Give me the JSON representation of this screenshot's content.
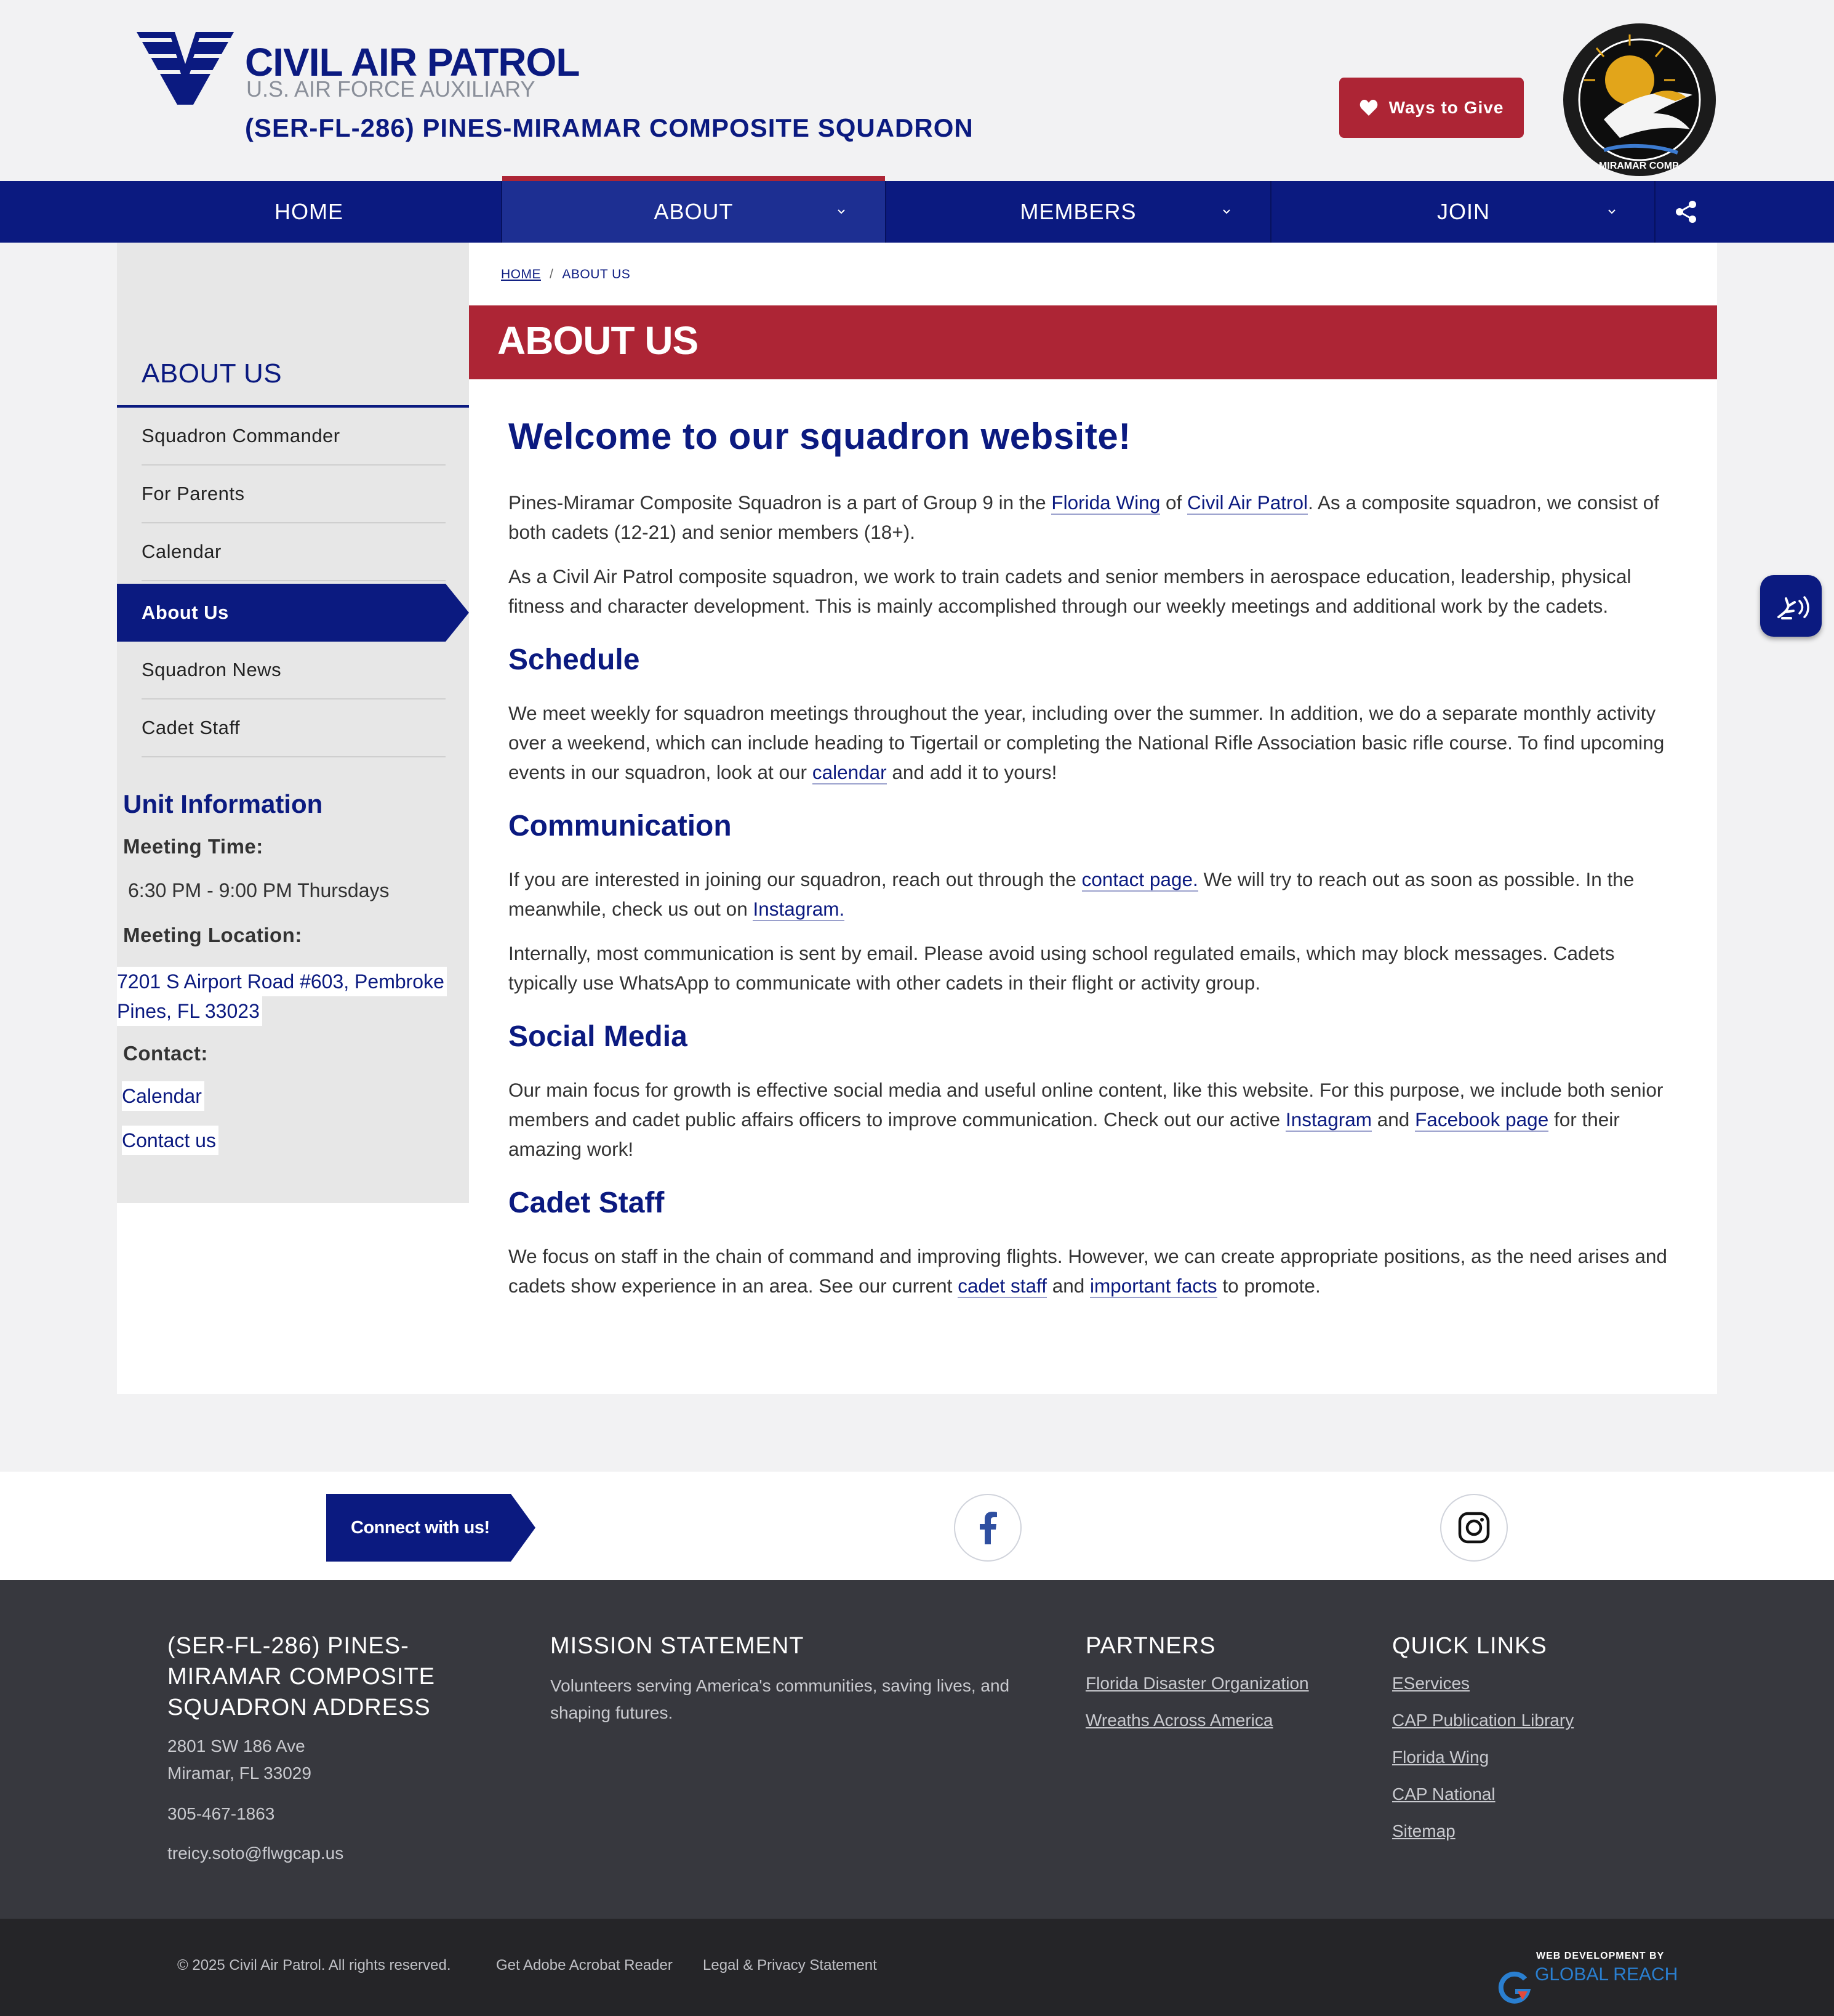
{
  "header": {
    "logo_main": "CIVIL AIR PATROL",
    "logo_sub": "U.S. AIR FORCE AUXILIARY",
    "squadron_name": "(SER-FL-286) PINES-MIRAMAR COMPOSITE SQUADRON",
    "give_label": "Ways to Give",
    "badge_text": "PINES - MIRAMAR COMP. SQUADRON"
  },
  "nav": {
    "items": [
      {
        "label": "HOME"
      },
      {
        "label": "ABOUT"
      },
      {
        "label": "MEMBERS"
      },
      {
        "label": "JOIN"
      }
    ]
  },
  "breadcrumb": {
    "home": "HOME",
    "sep": "/",
    "current": "ABOUT US"
  },
  "sidebar": {
    "title": "ABOUT US",
    "items": [
      {
        "label": "Squadron Commander"
      },
      {
        "label": "For Parents"
      },
      {
        "label": "Calendar"
      },
      {
        "label": "About Us"
      },
      {
        "label": "Squadron News"
      },
      {
        "label": "Cadet Staff"
      }
    ],
    "unit": {
      "title": "Unit Information",
      "meeting_time_label": "Meeting Time:",
      "meeting_time": "6:30 PM - 9:00 PM Thursdays",
      "meeting_location_label": "Meeting Location:",
      "address_line1": "7201 S Airport Road #603, Pembroke",
      "address_line2": "Pines, FL 33023",
      "contact_label": "Contact:",
      "calendar_link": "Calendar",
      "contact_link": "Contact us"
    }
  },
  "page": {
    "banner_title": "ABOUT US",
    "welcome": "Welcome to our squadron website!",
    "intro": {
      "t1": "Pines-Miramar Composite Squadron is a part of Group 9 in the ",
      "l1": "Florida Wing",
      "t2": " of ",
      "l2": "Civil Air Patrol",
      "t3": ". As a composite squadron, we consist of both cadets (12-21) and senior members (18+)."
    },
    "intro2": "As a Civil Air Patrol composite squadron, we work to train cadets and senior members in aerospace education, leadership, physical fitness and character development. This is mainly accomplished through our weekly meetings and additional work by the cadets.",
    "schedule_heading": "Schedule",
    "schedule": {
      "t1": "We meet weekly for squadron meetings throughout the year, including over the summer. In addition, we do a separate monthly activity over a weekend, which can include heading to Tigertail or completing the National Rifle Association basic rifle course. To find upcoming events in our squadron, look at our ",
      "l1": "calendar",
      "t2": " and add it to yours!"
    },
    "communication_heading": "Communication",
    "communication": {
      "t1": "If you are interested in joining our squadron, reach out through the ",
      "l1": "contact page.",
      "t2": " We will try to reach out as soon as possible. In the meanwhile, check us out on ",
      "l2": "Instagram."
    },
    "communication2": "Internally, most communication is sent by email. Please avoid using school regulated emails, which may block messages. Cadets typically use WhatsApp to communicate with other cadets in their flight or activity group.",
    "social_heading": "Social Media",
    "social": {
      "t1": "Our main focus for growth is effective social media and useful online content, like this website. For this purpose, we include both senior members and cadet public affairs officers to improve communication. Check out our active ",
      "l1": "Instagram",
      "t2": " and ",
      "l2": "Facebook page",
      "t3": " for their amazing work!"
    },
    "cadet_heading": "Cadet Staff",
    "cadet": {
      "t1": "We focus on staff in the chain of command and improving flights. However, we can create appropriate positions, as the need arises and cadets show experience in an area. See our current ",
      "l1": "cadet staff",
      "t2": " and ",
      "l2": "important facts",
      "t3": " to promote."
    }
  },
  "connect": {
    "label": "Connect with us!",
    "icons": [
      "facebook-icon",
      "instagram-icon"
    ]
  },
  "footer": {
    "address_heading": "(SER-FL-286) PINES-MIRAMAR COMPOSITE SQUADRON ADDRESS",
    "address_line1": "2801 SW 186 Ave",
    "address_line2": "Miramar, FL 33029",
    "phone": "305-467-1863",
    "email": "treicy.soto@flwgcap.us",
    "mission_heading": "MISSION STATEMENT",
    "mission": "Volunteers serving America's communities, saving lives, and shaping futures.",
    "partners_heading": "PARTNERS",
    "partners": [
      {
        "label": "Florida Disaster Organization"
      },
      {
        "label": "Wreaths Across America"
      }
    ],
    "quick_heading": "QUICK LINKS",
    "quick_links": [
      {
        "label": "EServices"
      },
      {
        "label": "CAP Publication Library"
      },
      {
        "label": "Florida Wing"
      },
      {
        "label": "CAP National"
      },
      {
        "label": "Sitemap"
      }
    ]
  },
  "bottom": {
    "copyright": "© 2025 Civil Air Patrol. All rights reserved.",
    "acrobat": "Get Adobe Acrobat Reader",
    "legal": "Legal & Privacy Statement",
    "dev_small": "WEB DEVELOPMENT BY",
    "dev_big": "GLOBAL REACH"
  },
  "colors": {
    "navy": "#0b1a80",
    "red": "#ad2535",
    "footer": "#37383e",
    "bottom": "#252528"
  }
}
